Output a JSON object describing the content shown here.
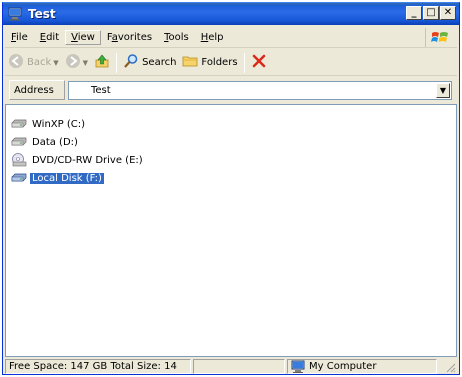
{
  "window": {
    "title": "Test",
    "controls": {
      "minimize": "_",
      "maximize": "□",
      "close": "✕"
    }
  },
  "menubar": {
    "items": [
      {
        "label": "File",
        "underline": "F"
      },
      {
        "label": "Edit",
        "underline": "E"
      },
      {
        "label": "View",
        "underline": "V",
        "active": true
      },
      {
        "label": "Favorites",
        "underline": "a"
      },
      {
        "label": "Tools",
        "underline": "T"
      },
      {
        "label": "Help",
        "underline": "H"
      }
    ]
  },
  "toolbar": {
    "back_label": "Back",
    "search_label": "Search",
    "folders_label": "Folders"
  },
  "address": {
    "label": "Address",
    "value": "Test"
  },
  "drives": [
    {
      "label": "WinXP (C:)",
      "icon": "hard-drive-icon",
      "selected": false
    },
    {
      "label": "Data (D:)",
      "icon": "hard-drive-icon",
      "selected": false
    },
    {
      "label": "DVD/CD-RW Drive (E:)",
      "icon": "cd-drive-icon",
      "selected": false
    },
    {
      "label": "Local Disk (F:)",
      "icon": "hard-drive-icon",
      "selected": true
    }
  ],
  "statusbar": {
    "info": "Free Space: 147 GB Total Size: 14",
    "location": "My Computer"
  },
  "colors": {
    "titlebar": "#1c5fd6",
    "selection": "#316ac5",
    "window_bg": "#ece9d8"
  }
}
